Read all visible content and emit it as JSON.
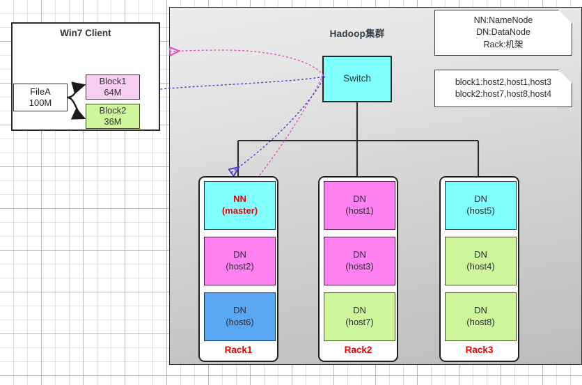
{
  "diagram": {
    "title": "Hadoop集群",
    "client": {
      "title": "Win7 Client",
      "file": {
        "name": "FileA",
        "size": "100M"
      },
      "blocks": [
        {
          "name": "Block1",
          "size": "64M",
          "color": "#f7cdf2"
        },
        {
          "name": "Block2",
          "size": "36M",
          "color": "#cdf59a"
        }
      ]
    },
    "switch": {
      "label": "Switch",
      "color": "#80ffff"
    },
    "notes": [
      {
        "lines": [
          "NN:NameNode",
          "DN:DataNode",
          "Rack:机架"
        ]
      },
      {
        "lines": [
          "block1:host2,host1,host3",
          "block2:host7,host8,host4"
        ]
      }
    ],
    "racks": [
      {
        "label": "Rack1",
        "nodes": [
          {
            "line1": "NN",
            "line2": "(master)",
            "color": "#80ffff",
            "style": "cyan",
            "master": true
          },
          {
            "line1": "DN",
            "line2": "(host2)",
            "color": "#ff80f0",
            "style": "magenta",
            "master": false
          },
          {
            "line1": "DN",
            "line2": "(host6)",
            "color": "#5aa7f2",
            "style": "blue",
            "master": false
          }
        ]
      },
      {
        "label": "Rack2",
        "nodes": [
          {
            "line1": "DN",
            "line2": "(host1)",
            "color": "#ff80f0",
            "style": "magenta",
            "master": false
          },
          {
            "line1": "DN",
            "line2": "(host3)",
            "color": "#ff80f0",
            "style": "magenta",
            "master": false
          },
          {
            "line1": "DN",
            "line2": "(host7)",
            "color": "#cdf59a",
            "style": "green",
            "master": false
          }
        ]
      },
      {
        "label": "Rack3",
        "nodes": [
          {
            "line1": "DN",
            "line2": "(host5)",
            "color": "#80ffff",
            "style": "cyan",
            "master": false
          },
          {
            "line1": "DN",
            "line2": "(host4)",
            "color": "#cdf59a",
            "style": "green",
            "master": false
          },
          {
            "line1": "DN",
            "line2": "(host8)",
            "color": "#cdf59a",
            "style": "green",
            "master": false
          }
        ]
      }
    ],
    "colors": {
      "panel_gray": "#d8d8d8",
      "rack_label": "#e60000",
      "arrow_pink": "#e060c0",
      "arrow_blue": "#4a3fd0",
      "connector": "#2b2b2b"
    }
  }
}
